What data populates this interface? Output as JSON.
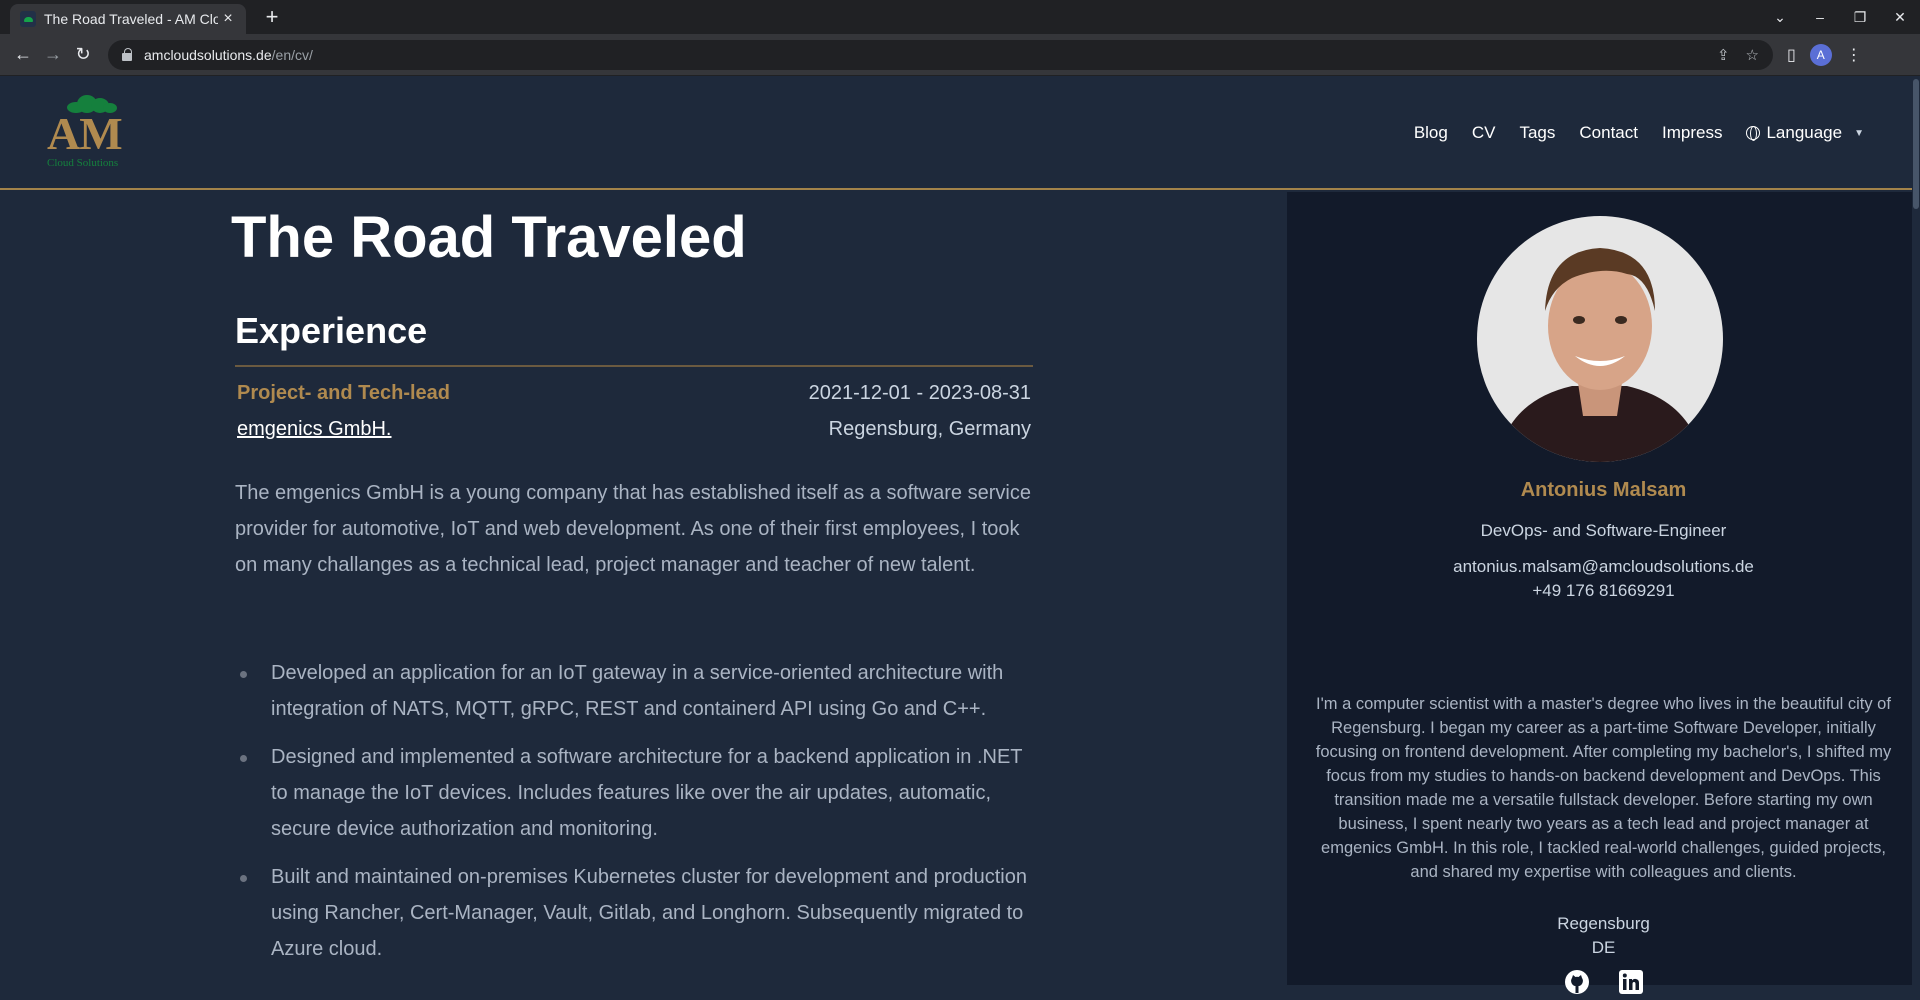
{
  "browser": {
    "tab_title": "The Road Traveled - AM Cloud Solutions",
    "tab_close": "×",
    "new_tab": "+",
    "url_host": "amcloudsolutions.de",
    "url_path": "/en/cv/",
    "profile_initial": "A"
  },
  "header": {
    "logo_text": "AM",
    "logo_subtitle": "Cloud Solutions",
    "nav": [
      "Blog",
      "CV",
      "Tags",
      "Contact",
      "Impress"
    ],
    "language_label": "Language"
  },
  "main": {
    "page_title": "The Road Traveled",
    "section_title": "Experience",
    "job": {
      "title": "Project- and Tech-lead",
      "dates": "2021-12-01 - 2023-08-31",
      "company": "emgenics GmbH.",
      "location": "Regensburg, Germany",
      "description": "The emgenics GmbH is a young company that has established itself as a software service provider for automotive, IoT and web development. As one of their first employees, I took on many challanges as a technical lead, project manager and teacher of new talent.",
      "bullets": [
        "Developed an application for an IoT gateway in a service-oriented architecture with integration of NATS, MQTT, gRPC, REST and containerd API using Go and C++.",
        "Designed and implemented a software architecture for a backend application in .NET to manage the IoT devices. Includes features like over the air updates, automatic, secure device authorization and monitoring.",
        "Built and maintained on-premises Kubernetes cluster for development and production using Rancher, Cert-Manager, Vault, Gitlab, and Longhorn. Subsequently migrated to Azure cloud."
      ]
    }
  },
  "sidebar": {
    "name": "Antonius Malsam",
    "role": "DevOps- and Software-Engineer",
    "email": "antonius.malsam@amcloudsolutions.de",
    "phone": "+49 176 81669291",
    "bio": "I'm a computer scientist with a master's degree who lives in the beautiful city of Regensburg. I began my career as a part-time Software Developer, initially focusing on frontend development. After completing my bachelor's, I shifted my focus from my studies to hands-on backend development and DevOps. This transition made me a versatile fullstack developer. Before starting my own business, I spent nearly two years as a tech lead and project manager at emgenics GmbH. In this role, I tackled real-world challenges, guided projects, and shared my expertise with colleagues and clients.",
    "city": "Regensburg",
    "country": "DE",
    "socials": [
      "github-icon",
      "linkedin-icon"
    ]
  },
  "colors": {
    "background": "#1e293b",
    "sidebar": "#121a2a",
    "accent": "#b08a4f",
    "text": "#aab4c3"
  }
}
